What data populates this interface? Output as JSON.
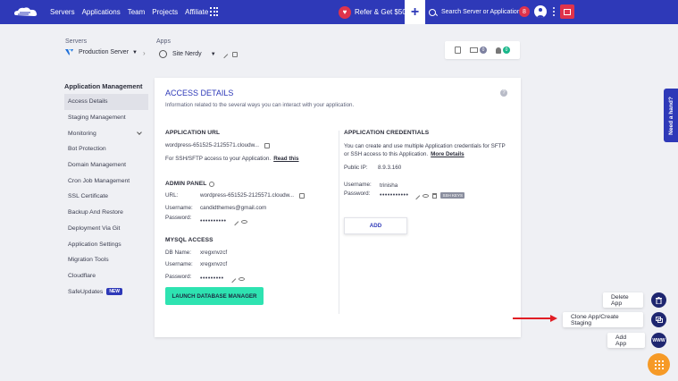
{
  "nav": {
    "links": [
      "Servers",
      "Applications",
      "Team",
      "Projects",
      "Affiliate"
    ],
    "refer_label": "Refer & Get $50",
    "search_placeholder": "Search Server or Application",
    "notification_count": "8"
  },
  "breadcrumb": {
    "servers_label": "Servers",
    "server_name": "Production Server",
    "apps_label": "Apps",
    "app_name": "Site Nerdy"
  },
  "top_icons": {
    "mail_count": "0",
    "user_count": "0"
  },
  "sidebar": {
    "title": "Application Management",
    "items": [
      {
        "label": "Access Details"
      },
      {
        "label": "Staging Management"
      },
      {
        "label": "Monitoring"
      },
      {
        "label": "Bot Protection"
      },
      {
        "label": "Domain Management"
      },
      {
        "label": "Cron Job Management"
      },
      {
        "label": "SSL Certificate"
      },
      {
        "label": "Backup And Restore"
      },
      {
        "label": "Deployment Via Git"
      },
      {
        "label": "Application Settings"
      },
      {
        "label": "Migration Tools"
      },
      {
        "label": "Cloudflare"
      },
      {
        "label": "SafeUpdates",
        "badge": "NEW"
      }
    ]
  },
  "access": {
    "title": "ACCESS DETAILS",
    "subtitle": "Information related to the several ways you can interact with your application.",
    "app_url": {
      "title": "APPLICATION URL",
      "url": "wordpress-651525-2125571.cloudw...",
      "ssh_note": "For SSH/SFTP access to your Application.",
      "read_this": "Read this"
    },
    "admin": {
      "title": "ADMIN PANEL",
      "url_label": "URL:",
      "url": "wordpress-651525-2125571.cloudw...",
      "username_label": "Username:",
      "username": "candidthemes@gmail.com",
      "password_label": "Password:",
      "password": "••••••••••"
    },
    "mysql": {
      "title": "MYSQL ACCESS",
      "db_label": "DB Name:",
      "db": "xregxnvzcf",
      "username_label": "Username:",
      "username": "xregxnvzcf",
      "password_label": "Password:",
      "password": "•••••••••",
      "launch": "LAUNCH DATABASE MANAGER"
    },
    "credentials": {
      "title": "APPLICATION CREDENTIALS",
      "line1": "You can create and use multiple Application credentials for SFTP",
      "line2": "or SSH access to this Application.",
      "more": "More Details",
      "ip_label": "Public IP:",
      "ip": "8.9.3.160",
      "username_label": "Username:",
      "username": "trinisha",
      "password_label": "Password:",
      "password": "•••••••••••",
      "ssh_keys": "SSH KEYS",
      "add": "ADD"
    }
  },
  "help": {
    "label": "Need a hand?"
  },
  "fab": {
    "delete": "Delete App",
    "clone": "Clone App/Create Staging",
    "add": "Add App",
    "www": "WWW"
  },
  "colors": {
    "brand": "#2e39b8",
    "accent_green": "#2ee3b1",
    "fab_orange": "#f69a27",
    "alert_red": "#e0334b"
  }
}
